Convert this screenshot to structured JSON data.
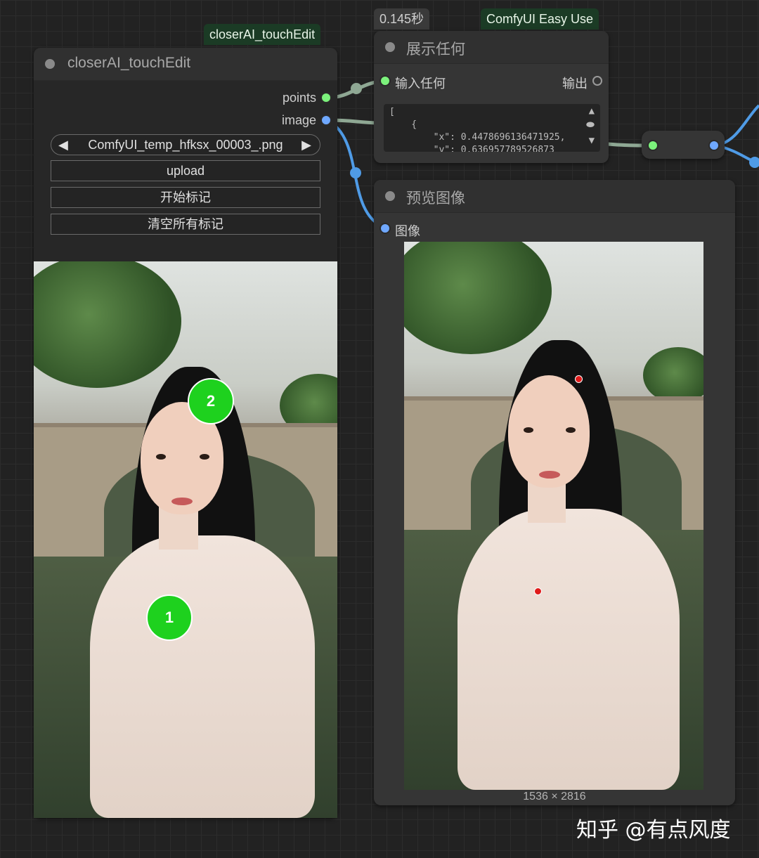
{
  "badges": {
    "touchedit": "closerAI_touchEdit",
    "timing": "0.145秒",
    "group": "ComfyUI Easy Use"
  },
  "touch_node": {
    "title": "closerAI_touchEdit",
    "outputs": [
      "points",
      "image"
    ],
    "combo_value": "ComfyUI_temp_hfksx_00003_.png",
    "combo_prev": "◀",
    "combo_next": "▶",
    "buttons": [
      "upload",
      "开始标记",
      "清空所有标记"
    ],
    "markers": [
      "1",
      "2"
    ]
  },
  "show_node": {
    "title": "展示任何",
    "input_label": "输入任何",
    "output_label": "输出",
    "text_lines": [
      "[",
      "    {",
      "        \"x\": 0.4478696136471925,",
      "        \"y\": 0.636957789526873"
    ],
    "scroll_up": "▲",
    "scroll_mid": "⬬",
    "scroll_down": "▼"
  },
  "preview_node": {
    "title": "预览图像",
    "input_label": "图像",
    "image_size": "1536 × 2816"
  },
  "watermark": "知乎 @有点风度",
  "colors": {
    "port_green": "#7cf27c",
    "port_blue": "#6fa8ff",
    "marker_green": "#1ed11e",
    "marker_red": "#e01b1b",
    "wire_blue": "#4f9be6",
    "wire_gray": "#8fa894"
  }
}
